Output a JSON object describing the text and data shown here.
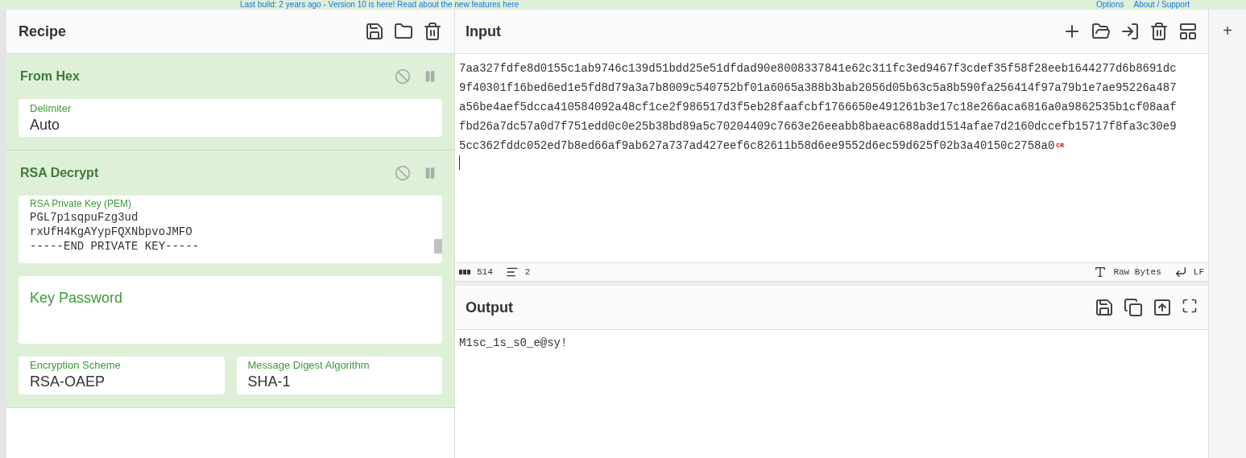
{
  "banner": {
    "text": "Last build: 2 years ago - Version 10 is here! Read about the new features here",
    "options": "Options",
    "about": "About / Support"
  },
  "recipe": {
    "title": "Recipe",
    "operations": [
      {
        "name": "From Hex",
        "disabled": false,
        "paused": false,
        "fields": [
          {
            "kind": "select",
            "label": "Delimiter",
            "value": "Auto"
          }
        ]
      },
      {
        "name": "RSA Decrypt",
        "disabled": false,
        "paused": false,
        "fields": [
          {
            "kind": "code",
            "label": "RSA Private Key (PEM)",
            "lines": [
              "PGL7p1sqpuFzg3ud",
              "rxUfH4KgAYypFQXNbpvoJMFO",
              "-----END PRIVATE KEY-----"
            ]
          },
          {
            "kind": "textarea",
            "placeholder": "Key Password"
          },
          {
            "kind": "pair",
            "items": [
              {
                "label": "Encryption Scheme",
                "value": "RSA-OAEP"
              },
              {
                "label": "Message Digest Algorithm",
                "value": "SHA-1"
              }
            ]
          }
        ]
      }
    ]
  },
  "input": {
    "title": "Input",
    "lines": [
      "7aa327fdfe8d0155c1ab9746c139d51bdd25e51dfdad90e8008337841e62c311fc3ed9467f3cdef35f58f28eeb1644277d6b8691dc",
      "9f40301f16bed6ed1e5fd8d79a3a7b8009c540752bf01a6065a388b3bab2056d05b63c5a8b590fa256414f97a79b1e7ae95226a487",
      "a56be4aef5dcca410584092a48cf1ce2f986517d3f5eb28faafcbf1766650e491261b3e17c18e266aca6816a0a9862535b1cf08aaf",
      "fbd26a7dc57a0d7f751edd0c0e25b38bd89a5c70204409c7663e26eeabb8baeac688add1514afae7d2160dccefb15717f8fa3c30e9",
      "5cc362fddc052ed7b8ed66af9ab627a737ad427eef6c82611b58d6ee9552d6ec59d625f02b3a40150c2758a0"
    ],
    "line_end_mark": "CR",
    "length": "514",
    "line_count": "2",
    "encoding": "Raw Bytes",
    "eol": "LF"
  },
  "output": {
    "title": "Output",
    "text": "M1sc_1s_s0_e@sy!"
  },
  "side_tab": "+"
}
